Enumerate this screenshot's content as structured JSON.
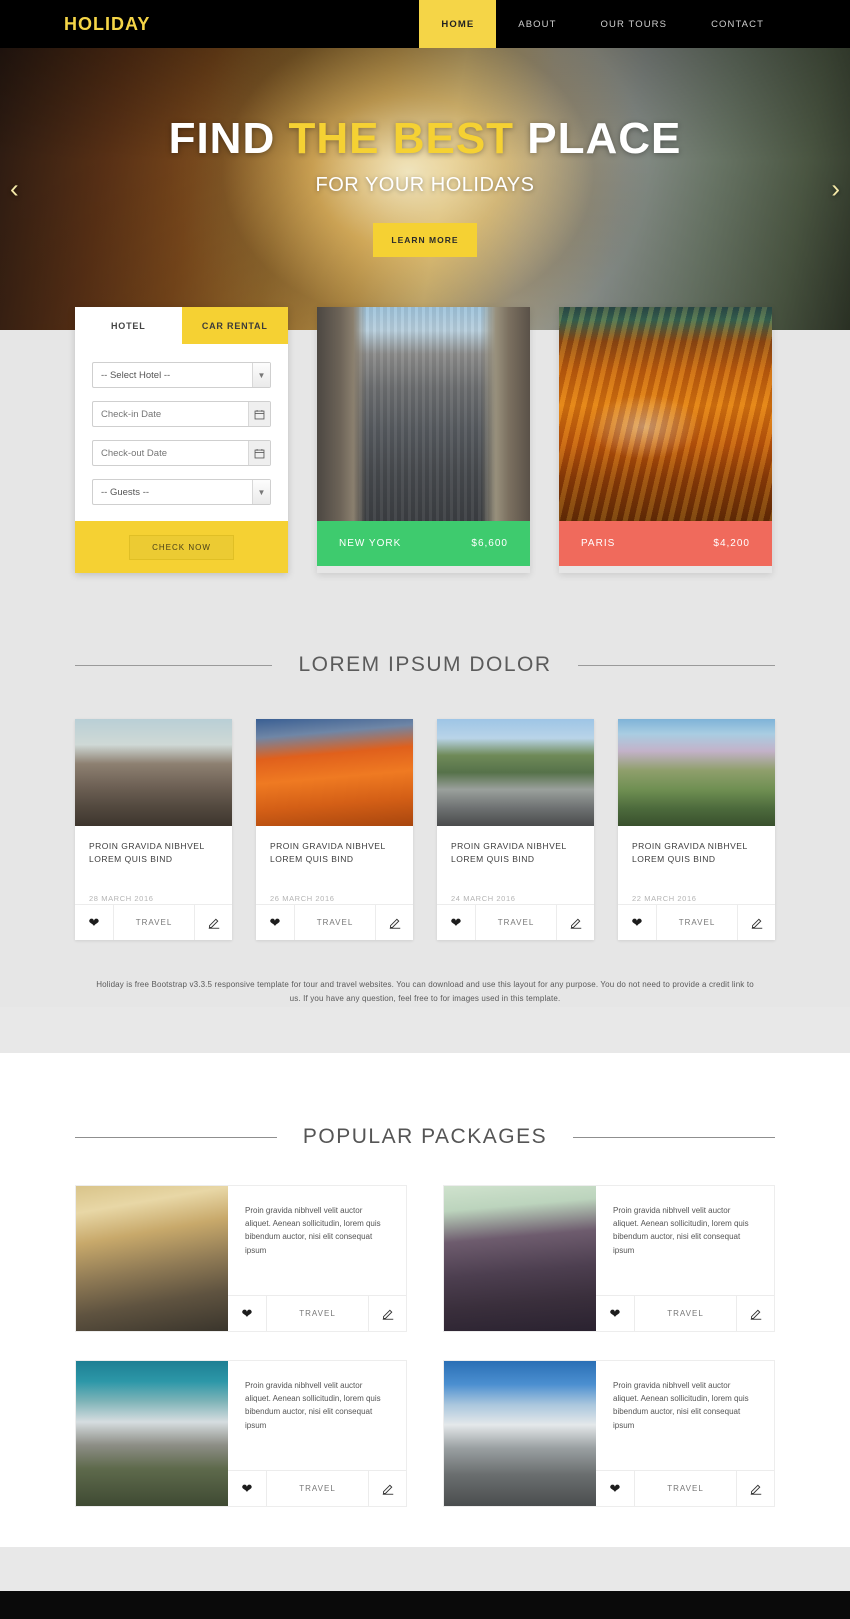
{
  "header": {
    "brand": "HOLIDAY",
    "nav": [
      {
        "label": "HOME",
        "active": true
      },
      {
        "label": "ABOUT",
        "active": false
      },
      {
        "label": "OUR TOURS",
        "active": false
      },
      {
        "label": "CONTACT",
        "active": false
      }
    ]
  },
  "hero": {
    "title_part1": "FIND ",
    "title_accent": "THE BEST",
    "title_part2": " PLACE",
    "subtitle": "FOR YOUR HOLIDAYS",
    "button": "LEARN MORE",
    "arrow_left": "‹",
    "arrow_right": "›"
  },
  "booking": {
    "tab_hotel": "HOTEL",
    "tab_car": "CAR RENTAL",
    "select_hotel": "-- Select Hotel --",
    "checkin_placeholder": "Check-in Date",
    "checkout_placeholder": "Check-out Date",
    "guests": "-- Guests --",
    "submit": "CHECK NOW"
  },
  "deals": [
    {
      "city": "NEW YORK",
      "price": "$6,600",
      "color": "#3ecb6e"
    },
    {
      "city": "PARIS",
      "price": "$4,200",
      "color": "#f06a5c"
    }
  ],
  "section_blog": {
    "heading": "LOREM IPSUM DOLOR",
    "cards": [
      {
        "title": "PROIN GRAVIDA NIBHVEL LOREM QUIS BIND",
        "date": "28 MARCH 2016",
        "tag": "TRAVEL"
      },
      {
        "title": "PROIN GRAVIDA NIBHVEL LOREM QUIS BIND",
        "date": "26 MARCH 2016",
        "tag": "TRAVEL"
      },
      {
        "title": "PROIN GRAVIDA NIBHVEL LOREM QUIS BIND",
        "date": "24 MARCH 2016",
        "tag": "TRAVEL"
      },
      {
        "title": "PROIN GRAVIDA NIBHVEL LOREM QUIS BIND",
        "date": "22 MARCH 2016",
        "tag": "TRAVEL"
      }
    ],
    "description": "Holiday is free Bootstrap v3.3.5 responsive template for tour and travel websites. You can download and use this layout for any purpose. You do not need to provide a credit link to us. If you have any question, feel free to for images used in this template."
  },
  "section_packages": {
    "heading": "POPULAR PACKAGES",
    "cards": [
      {
        "text": "Proin gravida nibhvell velit auctor aliquet. Aenean sollicitudin, lorem quis bibendum auctor, nisi elit consequat ipsum",
        "tag": "TRAVEL"
      },
      {
        "text": "Proin gravida nibhvell velit auctor aliquet. Aenean sollicitudin, lorem quis bibendum auctor, nisi elit consequat ipsum",
        "tag": "TRAVEL"
      },
      {
        "text": "Proin gravida nibhvell velit auctor aliquet. Aenean sollicitudin, lorem quis bibendum auctor, nisi elit consequat ipsum",
        "tag": "TRAVEL"
      },
      {
        "text": "Proin gravida nibhvell velit auctor aliquet. Aenean sollicitudin, lorem quis bibendum auctor, nisi elit consequat ipsum",
        "tag": "TRAVEL"
      }
    ]
  },
  "theme": {
    "accent": "#f5d133",
    "dark": "#000000",
    "page_bg": "#e6e6e6"
  }
}
